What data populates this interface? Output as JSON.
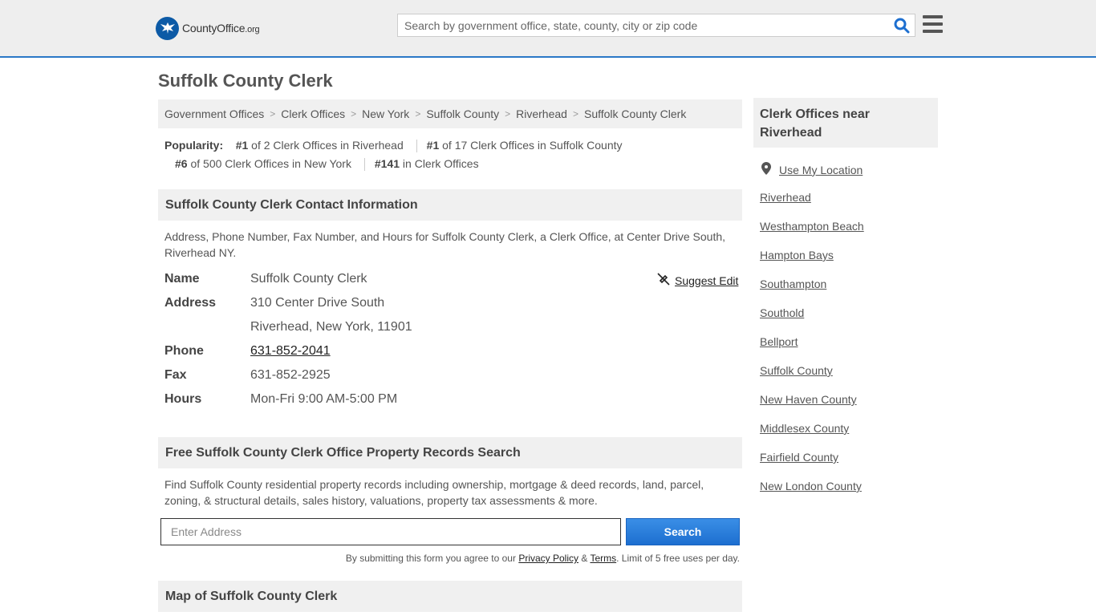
{
  "header": {
    "logo_text_a": "County",
    "logo_text_b": "Office",
    "logo_text_c": ".org",
    "search_placeholder": "Search by government office, state, county, city or zip code"
  },
  "page": {
    "title": "Suffolk County Clerk"
  },
  "breadcrumb": [
    "Government Offices",
    "Clerk Offices",
    "New York",
    "Suffolk County",
    "Riverhead",
    "Suffolk County Clerk"
  ],
  "popularity": {
    "label": "Popularity:",
    "items": [
      {
        "rank": "#1",
        "text": " of 2 Clerk Offices in Riverhead"
      },
      {
        "rank": "#1",
        "text": " of 17 Clerk Offices in Suffolk County"
      },
      {
        "rank": "#6",
        "text": " of 500 Clerk Offices in New York"
      },
      {
        "rank": "#141",
        "text": " in Clerk Offices"
      }
    ]
  },
  "contact": {
    "heading": "Suffolk County Clerk Contact Information",
    "description": "Address, Phone Number, Fax Number, and Hours for Suffolk County Clerk, a Clerk Office, at Center Drive South, Riverhead NY.",
    "suggest_edit": "Suggest Edit",
    "rows": {
      "name_label": "Name",
      "name_value": "Suffolk County Clerk",
      "address_label": "Address",
      "address_line1": "310 Center Drive South",
      "address_line2": "Riverhead, New York, 11901",
      "phone_label": "Phone",
      "phone_value": "631-852-2041",
      "fax_label": "Fax",
      "fax_value": "631-852-2925",
      "hours_label": "Hours",
      "hours_value": "Mon-Fri 9:00 AM-5:00 PM"
    }
  },
  "property": {
    "heading": "Free Suffolk County Clerk Office Property Records Search",
    "description": "Find Suffolk County residential property records including ownership, mortgage & deed records, land, parcel, zoning, & structural details, sales history, valuations, property tax assessments & more.",
    "input_placeholder": "Enter Address",
    "button_label": "Search",
    "terms_prefix": "By submitting this form you agree to our ",
    "privacy_label": "Privacy Policy",
    "amp": " & ",
    "terms_label": "Terms",
    "terms_suffix": ". Limit of 5 free uses per day."
  },
  "map": {
    "heading": "Map of Suffolk County Clerk"
  },
  "sidebar": {
    "heading": "Clerk Offices near Riverhead",
    "use_location": "Use My Location",
    "links": [
      "Riverhead",
      "Westhampton Beach",
      "Hampton Bays",
      "Southampton",
      "Southold",
      "Bellport",
      "Suffolk County",
      "New Haven County",
      "Middlesex County",
      "Fairfield County",
      "New London County"
    ]
  },
  "colors": {
    "accent": "#2b78c7",
    "button": "#1d6fd0",
    "logo": "#0c5aa6"
  }
}
